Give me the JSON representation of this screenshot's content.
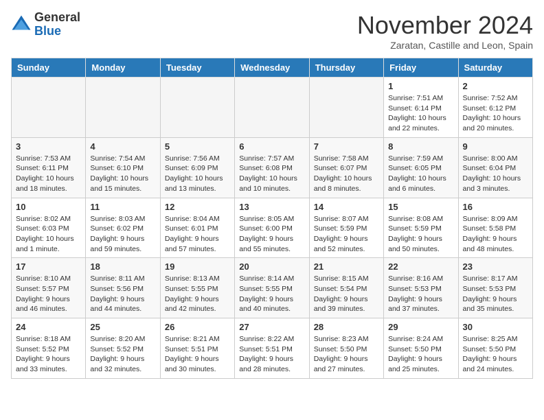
{
  "header": {
    "logo_general": "General",
    "logo_blue": "Blue",
    "month": "November 2024",
    "location": "Zaratan, Castille and Leon, Spain"
  },
  "weekdays": [
    "Sunday",
    "Monday",
    "Tuesday",
    "Wednesday",
    "Thursday",
    "Friday",
    "Saturday"
  ],
  "weeks": [
    [
      {
        "day": "",
        "info": "",
        "empty": true
      },
      {
        "day": "",
        "info": "",
        "empty": true
      },
      {
        "day": "",
        "info": "",
        "empty": true
      },
      {
        "day": "",
        "info": "",
        "empty": true
      },
      {
        "day": "",
        "info": "",
        "empty": true
      },
      {
        "day": "1",
        "info": "Sunrise: 7:51 AM\nSunset: 6:14 PM\nDaylight: 10 hours\nand 22 minutes."
      },
      {
        "day": "2",
        "info": "Sunrise: 7:52 AM\nSunset: 6:12 PM\nDaylight: 10 hours\nand 20 minutes."
      }
    ],
    [
      {
        "day": "3",
        "info": "Sunrise: 7:53 AM\nSunset: 6:11 PM\nDaylight: 10 hours\nand 18 minutes."
      },
      {
        "day": "4",
        "info": "Sunrise: 7:54 AM\nSunset: 6:10 PM\nDaylight: 10 hours\nand 15 minutes."
      },
      {
        "day": "5",
        "info": "Sunrise: 7:56 AM\nSunset: 6:09 PM\nDaylight: 10 hours\nand 13 minutes."
      },
      {
        "day": "6",
        "info": "Sunrise: 7:57 AM\nSunset: 6:08 PM\nDaylight: 10 hours\nand 10 minutes."
      },
      {
        "day": "7",
        "info": "Sunrise: 7:58 AM\nSunset: 6:07 PM\nDaylight: 10 hours\nand 8 minutes."
      },
      {
        "day": "8",
        "info": "Sunrise: 7:59 AM\nSunset: 6:05 PM\nDaylight: 10 hours\nand 6 minutes."
      },
      {
        "day": "9",
        "info": "Sunrise: 8:00 AM\nSunset: 6:04 PM\nDaylight: 10 hours\nand 3 minutes."
      }
    ],
    [
      {
        "day": "10",
        "info": "Sunrise: 8:02 AM\nSunset: 6:03 PM\nDaylight: 10 hours\nand 1 minute."
      },
      {
        "day": "11",
        "info": "Sunrise: 8:03 AM\nSunset: 6:02 PM\nDaylight: 9 hours\nand 59 minutes."
      },
      {
        "day": "12",
        "info": "Sunrise: 8:04 AM\nSunset: 6:01 PM\nDaylight: 9 hours\nand 57 minutes."
      },
      {
        "day": "13",
        "info": "Sunrise: 8:05 AM\nSunset: 6:00 PM\nDaylight: 9 hours\nand 55 minutes."
      },
      {
        "day": "14",
        "info": "Sunrise: 8:07 AM\nSunset: 5:59 PM\nDaylight: 9 hours\nand 52 minutes."
      },
      {
        "day": "15",
        "info": "Sunrise: 8:08 AM\nSunset: 5:59 PM\nDaylight: 9 hours\nand 50 minutes."
      },
      {
        "day": "16",
        "info": "Sunrise: 8:09 AM\nSunset: 5:58 PM\nDaylight: 9 hours\nand 48 minutes."
      }
    ],
    [
      {
        "day": "17",
        "info": "Sunrise: 8:10 AM\nSunset: 5:57 PM\nDaylight: 9 hours\nand 46 minutes."
      },
      {
        "day": "18",
        "info": "Sunrise: 8:11 AM\nSunset: 5:56 PM\nDaylight: 9 hours\nand 44 minutes."
      },
      {
        "day": "19",
        "info": "Sunrise: 8:13 AM\nSunset: 5:55 PM\nDaylight: 9 hours\nand 42 minutes."
      },
      {
        "day": "20",
        "info": "Sunrise: 8:14 AM\nSunset: 5:55 PM\nDaylight: 9 hours\nand 40 minutes."
      },
      {
        "day": "21",
        "info": "Sunrise: 8:15 AM\nSunset: 5:54 PM\nDaylight: 9 hours\nand 39 minutes."
      },
      {
        "day": "22",
        "info": "Sunrise: 8:16 AM\nSunset: 5:53 PM\nDaylight: 9 hours\nand 37 minutes."
      },
      {
        "day": "23",
        "info": "Sunrise: 8:17 AM\nSunset: 5:53 PM\nDaylight: 9 hours\nand 35 minutes."
      }
    ],
    [
      {
        "day": "24",
        "info": "Sunrise: 8:18 AM\nSunset: 5:52 PM\nDaylight: 9 hours\nand 33 minutes."
      },
      {
        "day": "25",
        "info": "Sunrise: 8:20 AM\nSunset: 5:52 PM\nDaylight: 9 hours\nand 32 minutes."
      },
      {
        "day": "26",
        "info": "Sunrise: 8:21 AM\nSunset: 5:51 PM\nDaylight: 9 hours\nand 30 minutes."
      },
      {
        "day": "27",
        "info": "Sunrise: 8:22 AM\nSunset: 5:51 PM\nDaylight: 9 hours\nand 28 minutes."
      },
      {
        "day": "28",
        "info": "Sunrise: 8:23 AM\nSunset: 5:50 PM\nDaylight: 9 hours\nand 27 minutes."
      },
      {
        "day": "29",
        "info": "Sunrise: 8:24 AM\nSunset: 5:50 PM\nDaylight: 9 hours\nand 25 minutes."
      },
      {
        "day": "30",
        "info": "Sunrise: 8:25 AM\nSunset: 5:50 PM\nDaylight: 9 hours\nand 24 minutes."
      }
    ]
  ]
}
